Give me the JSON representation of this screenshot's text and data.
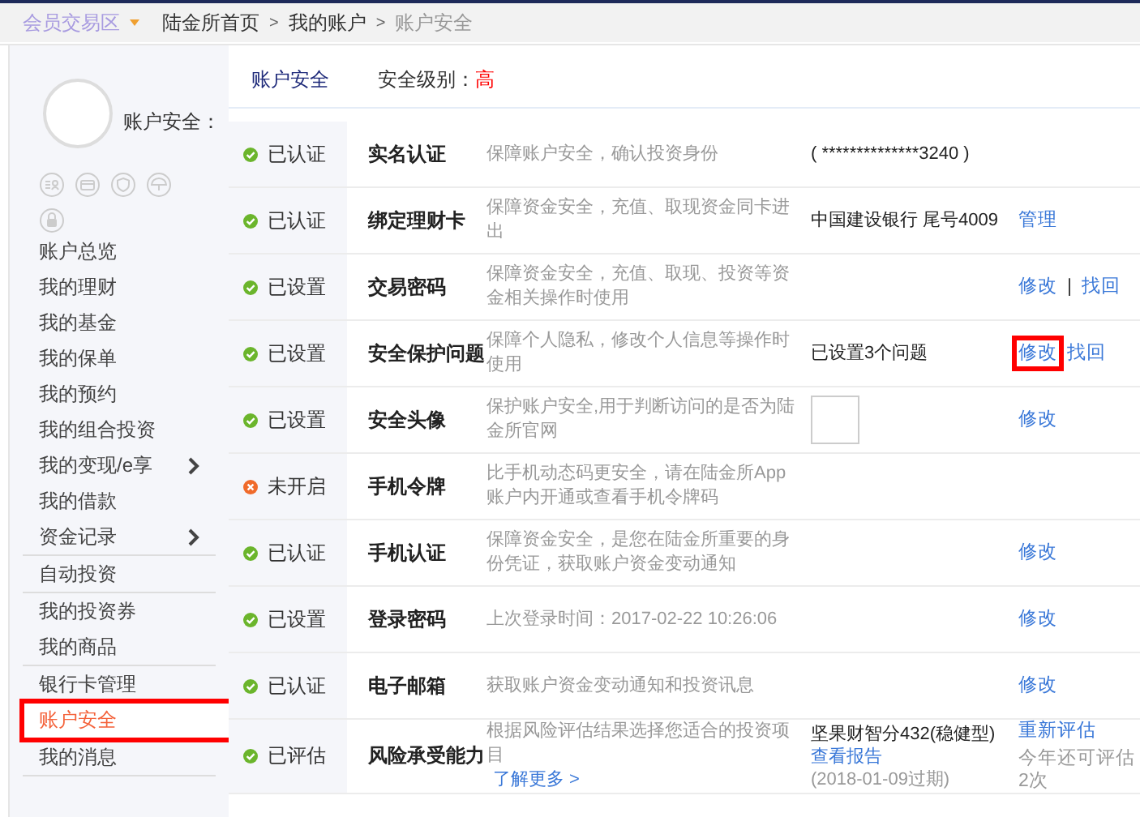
{
  "breadcrumb": {
    "zone": "会员交易区",
    "items": [
      {
        "label": "陆金所首页",
        "current": false
      },
      {
        "label": "我的账户",
        "current": false
      },
      {
        "label": "账户安全",
        "current": true
      }
    ],
    "separator": ">"
  },
  "sidebar": {
    "profile_label": "账户安全：",
    "items": [
      {
        "label": "账户总览",
        "selected": false,
        "expandable": false,
        "divider": false,
        "highlighted": false
      },
      {
        "label": "我的理财",
        "selected": false,
        "expandable": false,
        "divider": false,
        "highlighted": false
      },
      {
        "label": "我的基金",
        "selected": false,
        "expandable": false,
        "divider": false,
        "highlighted": false
      },
      {
        "label": "我的保单",
        "selected": false,
        "expandable": false,
        "divider": false,
        "highlighted": false
      },
      {
        "label": "我的预约",
        "selected": false,
        "expandable": false,
        "divider": false,
        "highlighted": false
      },
      {
        "label": "我的组合投资",
        "selected": false,
        "expandable": false,
        "divider": false,
        "highlighted": false
      },
      {
        "label": "我的变现/e享",
        "selected": false,
        "expandable": true,
        "divider": false,
        "highlighted": false
      },
      {
        "label": "我的借款",
        "selected": false,
        "expandable": false,
        "divider": false,
        "highlighted": false
      },
      {
        "label": "资金记录",
        "selected": false,
        "expandable": true,
        "divider": true,
        "highlighted": false
      },
      {
        "label": "自动投资",
        "selected": false,
        "expandable": false,
        "divider": true,
        "highlighted": false
      },
      {
        "label": "我的投资券",
        "selected": false,
        "expandable": false,
        "divider": false,
        "highlighted": false
      },
      {
        "label": "我的商品",
        "selected": false,
        "expandable": false,
        "divider": true,
        "highlighted": false
      },
      {
        "label": "银行卡管理",
        "selected": false,
        "expandable": false,
        "divider": false,
        "highlighted": false
      },
      {
        "label": "账户安全",
        "selected": true,
        "expandable": false,
        "divider": true,
        "highlighted": true
      },
      {
        "label": "我的消息",
        "selected": false,
        "expandable": false,
        "divider": true,
        "highlighted": false
      }
    ]
  },
  "header": {
    "title": "账户安全",
    "level_label": "安全级别：",
    "level_value": "高"
  },
  "rows": [
    {
      "status": "已认证",
      "kind": "ok",
      "name": "实名认证",
      "desc": "保障账户安全，确认投资身份",
      "info": [
        {
          "kind": "text",
          "text": "( **************3240 )"
        }
      ],
      "actions": []
    },
    {
      "status": "已认证",
      "kind": "ok",
      "name": "绑定理财卡",
      "desc": "保障资金安全，充值、取现资金同卡进出",
      "info": [
        {
          "kind": "text",
          "text": "中国建设银行 尾号4009"
        }
      ],
      "actions": [
        {
          "kind": "link",
          "label": "管理"
        }
      ]
    },
    {
      "status": "已设置",
      "kind": "ok",
      "name": "交易密码",
      "desc": "保障资金安全，充值、取现、投资等资金相关操作时使用",
      "info": [],
      "actions": [
        {
          "kind": "link",
          "label": "修改"
        },
        {
          "kind": "sep",
          "label": "|"
        },
        {
          "kind": "link",
          "label": "找回"
        }
      ]
    },
    {
      "status": "已设置",
      "kind": "ok",
      "name": "安全保护问题",
      "desc": "保障个人隐私，修改个人信息等操作时使用",
      "info": [
        {
          "kind": "text",
          "text": "已设置3个问题"
        }
      ],
      "actions": [
        {
          "kind": "link",
          "label": "修改",
          "highlighted": true
        },
        {
          "kind": "link",
          "label": "找回"
        }
      ]
    },
    {
      "status": "已设置",
      "kind": "ok",
      "name": "安全头像",
      "desc": "保护账户安全,用于判断访问的是否为陆金所官网",
      "info": [
        {
          "kind": "image"
        }
      ],
      "actions": [
        {
          "kind": "link",
          "label": "修改"
        }
      ]
    },
    {
      "status": "未开启",
      "kind": "off",
      "name": "手机令牌",
      "desc": "比手机动态码更安全，请在陆金所App账户内开通或查看手机令牌码",
      "info": [],
      "actions": []
    },
    {
      "status": "已认证",
      "kind": "ok",
      "name": "手机认证",
      "desc": "保障资金安全，是您在陆金所重要的身份凭证，获取账户资金变动通知",
      "info": [],
      "actions": [
        {
          "kind": "link",
          "label": "修改"
        }
      ]
    },
    {
      "status": "已设置",
      "kind": "ok",
      "name": "登录密码",
      "desc": "上次登录时间：2017-02-22 10:26:06",
      "info": [],
      "actions": [
        {
          "kind": "link",
          "label": "修改"
        }
      ]
    },
    {
      "status": "已认证",
      "kind": "ok",
      "name": "电子邮箱",
      "desc": "获取账户资金变动通知和投资讯息",
      "info": [],
      "actions": [
        {
          "kind": "link",
          "label": "修改"
        }
      ]
    },
    {
      "status": "已评估",
      "kind": "ok",
      "name": "风险承受能力",
      "desc": "根据风险评估结果选择您适合的投资项目",
      "desc_link": "了解更多 >",
      "info": [
        {
          "kind": "text",
          "text": "坚果财智分432(稳健型)"
        },
        {
          "kind": "link",
          "text": "查看报告"
        },
        {
          "kind": "note",
          "text": "(2018-01-09过期)"
        }
      ],
      "actions": [
        {
          "kind": "link",
          "label": "重新评估"
        },
        {
          "kind": "note",
          "label": "今年还可评估2次"
        }
      ]
    }
  ]
}
